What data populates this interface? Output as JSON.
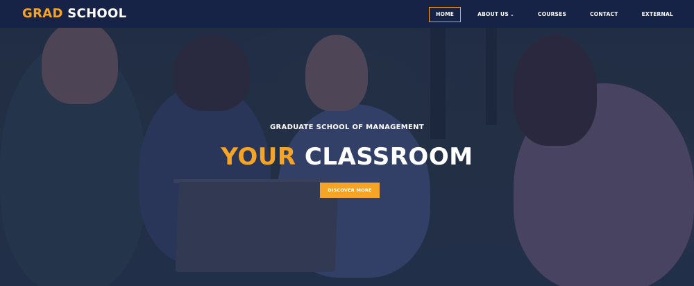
{
  "brand": {
    "logo_accent": "GRAD",
    "logo_light": "SCHOOL",
    "accent_color": "#f5a425",
    "navbar_color": "#172346"
  },
  "nav": {
    "items": [
      {
        "label": "HOME",
        "active": true
      },
      {
        "label": "ABOUT US",
        "has_dropdown": true
      },
      {
        "label": "COURSES"
      },
      {
        "label": "CONTACT"
      },
      {
        "label": "EXTERNAL"
      }
    ],
    "dropdown_icon": "chevron-down-icon"
  },
  "hero": {
    "kicker": "GRADUATE SCHOOL OF MANAGEMENT",
    "headline_accent": "YOUR",
    "headline_light": "CLASSROOM",
    "cta_label": "DISCOVER MORE"
  }
}
